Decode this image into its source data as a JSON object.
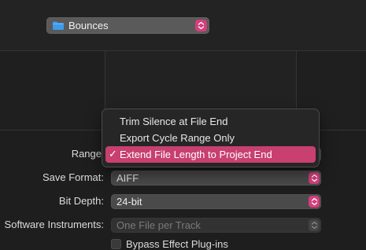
{
  "location": {
    "label": "Bounces",
    "icon": "folder-icon"
  },
  "form": {
    "range_label": "Range",
    "save_format_label": "Save Format:",
    "save_format_value": "AIFF",
    "bit_depth_label": "Bit Depth:",
    "bit_depth_value": "24-bit",
    "software_instruments_label": "Software Instruments:",
    "software_instruments_value": "One File per Track",
    "bypass_label": "Bypass Effect Plug-ins"
  },
  "range_menu": {
    "items": [
      {
        "label": "Trim Silence at File End",
        "selected": false
      },
      {
        "label": "Export Cycle Range Only",
        "selected": false
      },
      {
        "label": "Extend File Length to Project End",
        "selected": true
      }
    ],
    "checkmark": "✓"
  },
  "colors": {
    "accent": "#c8406f",
    "background": "#1e1e1e"
  }
}
